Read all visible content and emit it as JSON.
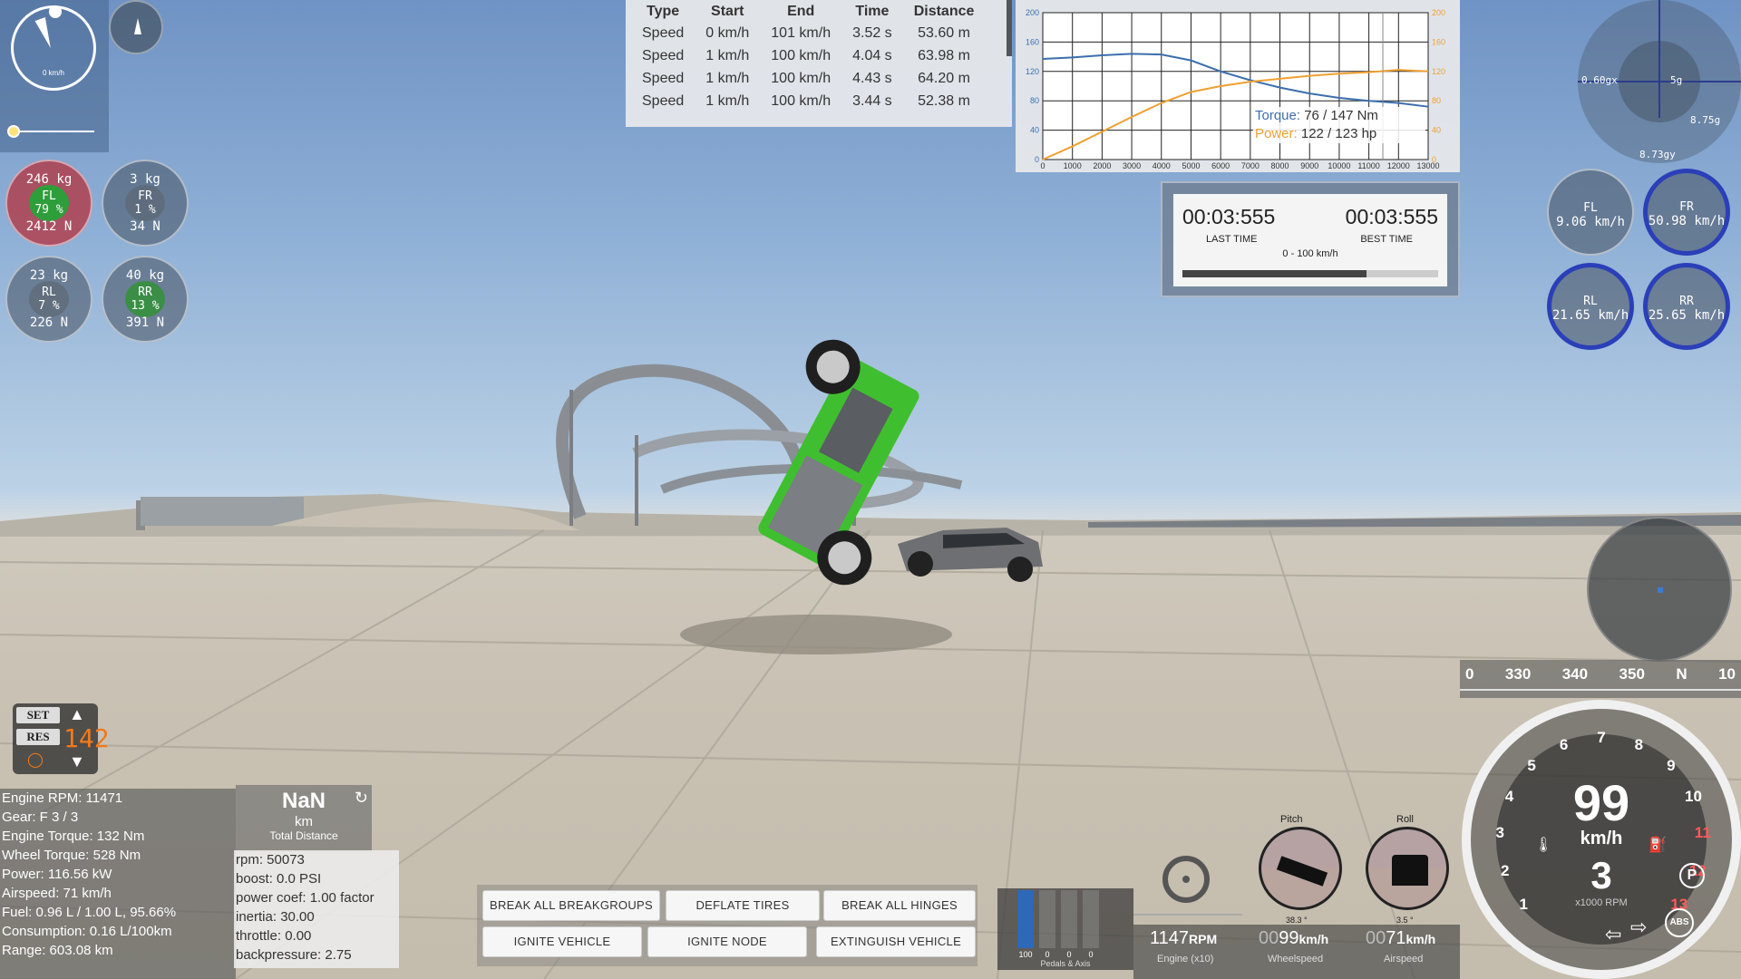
{
  "mini_speedo": {
    "label": "0 km/h"
  },
  "wheels_load": [
    {
      "id": "FL",
      "mass": "246 kg",
      "pct": "79 %",
      "force": "2412 N"
    },
    {
      "id": "FR",
      "mass": "3 kg",
      "pct": "1 %",
      "force": "34 N"
    },
    {
      "id": "RL",
      "mass": "23 kg",
      "pct": "7 %",
      "force": "226 N"
    },
    {
      "id": "RR",
      "mass": "40 kg",
      "pct": "13 %",
      "force": "391 N"
    }
  ],
  "run_table": {
    "headers": [
      "Type",
      "Start",
      "End",
      "Time",
      "Distance"
    ],
    "rows": [
      [
        "Speed",
        "0 km/h",
        "101 km/h",
        "3.52 s",
        "53.60 m"
      ],
      [
        "Speed",
        "1 km/h",
        "100 km/h",
        "4.04 s",
        "63.98 m"
      ],
      [
        "Speed",
        "1 km/h",
        "100 km/h",
        "4.43 s",
        "64.20 m"
      ],
      [
        "Speed",
        "1 km/h",
        "100 km/h",
        "3.44 s",
        "52.38 m"
      ]
    ]
  },
  "graph": {
    "torque_label": "Torque:",
    "torque_value": "76 / 147 Nm",
    "power_label": "Power:",
    "power_value": "122 / 123 hp",
    "x_ticks": [
      "0",
      "1000",
      "2000",
      "3000",
      "4000",
      "5000",
      "6000",
      "7000",
      "8000",
      "9000",
      "10000",
      "11000",
      "12000",
      "13000"
    ],
    "y_ticks": [
      "200",
      "160",
      "120",
      "80",
      "40",
      "0"
    ],
    "torque_color": "#3b6fae",
    "power_color": "#f0a030"
  },
  "timer": {
    "last": "00:03:555",
    "last_label": "LAST TIME",
    "best": "00:03:555",
    "best_label": "BEST TIME",
    "range": "0 - 100 km/h",
    "progress": 0.72
  },
  "gforce": {
    "x": "0.60gx",
    "y": "8.75g",
    "z": "8.73gy",
    "s": "5g"
  },
  "wheel_speeds": [
    {
      "id": "FL",
      "speed": "9.06 km/h"
    },
    {
      "id": "FR",
      "speed": "50.98 km/h"
    },
    {
      "id": "RL",
      "speed": "21.65 km/h"
    },
    {
      "id": "RR",
      "speed": "25.65 km/h"
    }
  ],
  "heading": {
    "ticks": [
      "0",
      "330",
      "340",
      "350",
      "N",
      "10"
    ]
  },
  "dashboard": {
    "speed": "99",
    "unit": "km/h",
    "gear": "3",
    "rpm_label": "x1000 RPM",
    "rpm_ticks": [
      "1",
      "2",
      "3",
      "4",
      "5",
      "6",
      "7",
      "8",
      "9",
      "10",
      "11",
      "12",
      "13"
    ],
    "abs": "ABS",
    "park": "P"
  },
  "cruise": {
    "set": "SET",
    "res": "RES",
    "speed": "142"
  },
  "info": [
    "Engine RPM: 11471",
    "Gear: F 3 / 3",
    "Engine Torque: 132 Nm",
    "Wheel Torque: 528 Nm",
    "Power: 116.56 kW",
    "Airspeed: 71 km/h",
    "Fuel: 0.96 L / 1.00 L, 95.66%",
    "Consumption: 0.16 L/100km",
    "Range: 603.08 km"
  ],
  "distance": {
    "value": "NaN",
    "unit": "km",
    "label": "Total Distance"
  },
  "engine": [
    "rpm: 50073",
    "boost: 0.0 PSI",
    "power coef: 1.00 factor",
    "inertia: 30.00",
    "throttle: 0.00",
    "backpressure: 2.75"
  ],
  "buttons": {
    "break_groups": "BREAK ALL BREAKGROUPS",
    "deflate": "DEFLATE TIRES",
    "break_hinges": "BREAK ALL HINGES",
    "ignite_vehicle": "IGNITE VEHICLE",
    "ignite_node": "IGNITE NODE",
    "extinguish": "EXTINGUISH VEHICLE"
  },
  "pedals": {
    "values": [
      "100",
      "0",
      "0",
      "0"
    ],
    "label": "Pedals & Axis"
  },
  "bottom_gauges": {
    "rpm": "1147",
    "rpm_unit": "RPM",
    "rpm_label": "Engine (x10)",
    "wheelspeed_prefix": "00",
    "wheelspeed": "99",
    "wheelspeed_unit": "km/h",
    "wheelspeed_label": "Wheelspeed",
    "airspeed_prefix": "00",
    "airspeed": "71",
    "airspeed_unit": "km/h",
    "airspeed_label": "Airspeed"
  },
  "attitude": {
    "pitch_label": "Pitch",
    "pitch_value": "38.3 °",
    "roll_label": "Roll",
    "roll_value": "3.5 °"
  }
}
